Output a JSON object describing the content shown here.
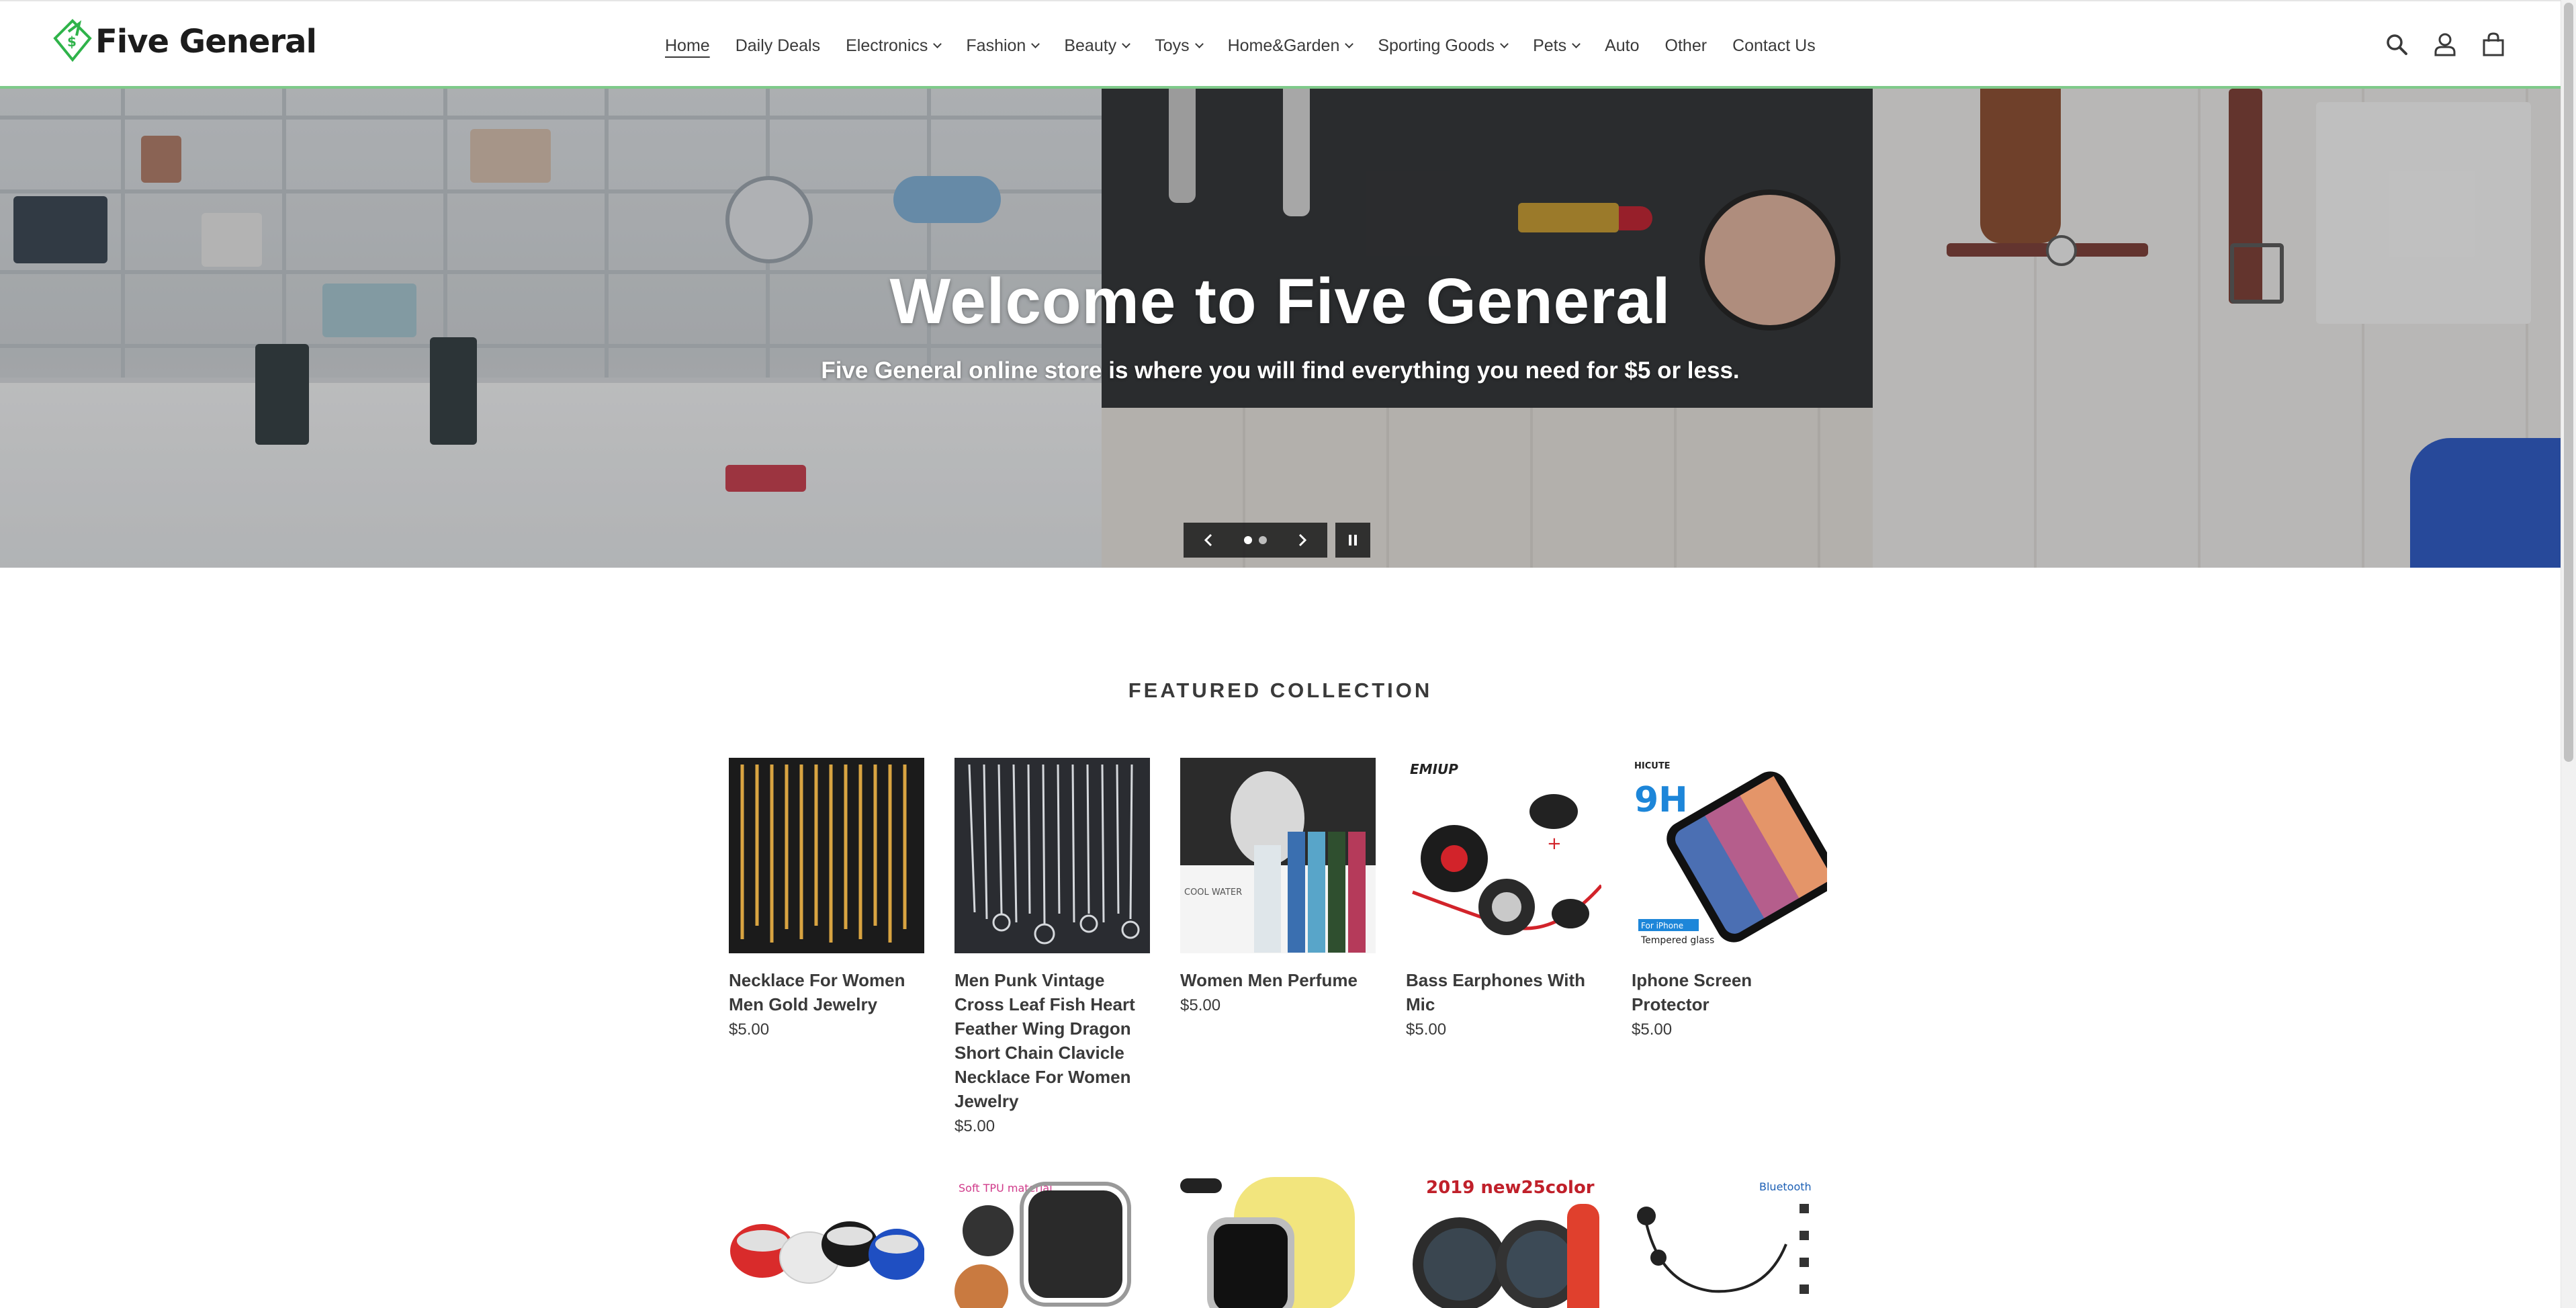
{
  "header": {
    "logo_text": "Five General",
    "nav": [
      {
        "label": "Home",
        "dropdown": false,
        "active": true
      },
      {
        "label": "Daily Deals",
        "dropdown": false
      },
      {
        "label": "Electronics",
        "dropdown": true
      },
      {
        "label": "Fashion",
        "dropdown": true
      },
      {
        "label": "Beauty",
        "dropdown": true
      },
      {
        "label": "Toys",
        "dropdown": true
      },
      {
        "label": "Home&Garden",
        "dropdown": true
      },
      {
        "label": "Sporting Goods",
        "dropdown": true
      },
      {
        "label": "Pets",
        "dropdown": true
      },
      {
        "label": "Auto",
        "dropdown": false
      },
      {
        "label": "Other",
        "dropdown": false
      },
      {
        "label": "Contact Us",
        "dropdown": false
      }
    ],
    "icons": [
      "search-icon",
      "account-icon",
      "cart-icon"
    ]
  },
  "hero": {
    "title": "Welcome to Five General",
    "subtitle": "Five General online store is where you will find everything you need for $5 or less.",
    "slide_count": 2,
    "active_slide": 1
  },
  "featured": {
    "title": "FEATURED COLLECTION",
    "products": [
      {
        "title": "Necklace For Women Men Gold Jewelry",
        "price": "$5.00"
      },
      {
        "title": "Men Punk Vintage Cross Leaf Fish Heart Feather Wing Dragon Short Chain Clavicle Necklace For Women Jewelry",
        "price": "$5.00"
      },
      {
        "title": "Women Men Perfume",
        "price": "$5.00"
      },
      {
        "title": "Bass Earphones With Mic",
        "price": "$5.00"
      },
      {
        "title": "Iphone Screen Protector",
        "price": "$5.00"
      }
    ],
    "image_text": {
      "perfume": "COOL WATER",
      "earphones_brand": "EMIUP",
      "screen_brand": "HICUTE",
      "screen_badge": "9H",
      "screen_tag1": "For iPhone",
      "screen_tag2": "Tempered glass",
      "case_label": "Soft TPU material",
      "band_label": "2019 new25color",
      "bt_label": "Bluetooth"
    }
  },
  "colors": {
    "accent_green": "#7fca8a",
    "text": "#3a3a3a"
  }
}
